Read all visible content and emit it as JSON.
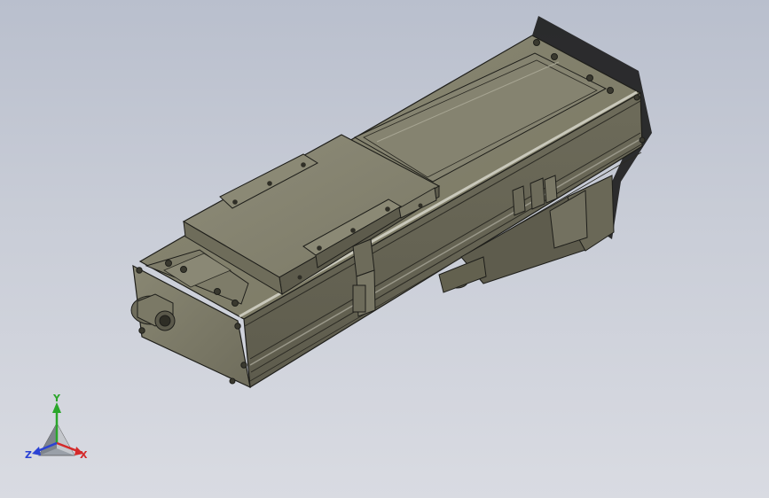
{
  "viewport": {
    "background_top": "#b9bfcd",
    "background_bottom": "#d9dbe2"
  },
  "model": {
    "name": "linear-actuator-stage",
    "body_color": "#7f7d6b",
    "edge_color": "#1e1e1a",
    "highlight_color": "#c9c8bb"
  },
  "triad": {
    "x_label": "X",
    "y_label": "Y",
    "z_label": "Z",
    "x_color": "#d42a2a",
    "y_color": "#2aa62a",
    "z_color": "#2a42d4",
    "icon": "axis-triad-icon"
  }
}
